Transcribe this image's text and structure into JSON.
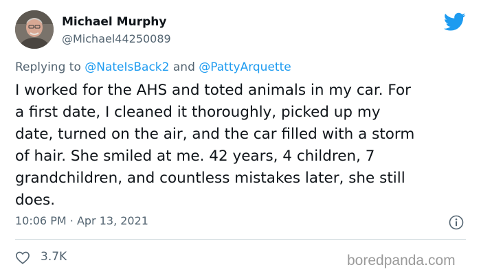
{
  "author": {
    "display_name": "Michael Murphy",
    "handle": "@Michael44250089",
    "avatar_icon": "profile-photo"
  },
  "logo": {
    "icon": "twitter-bird-icon",
    "color": "#1d9bf0"
  },
  "reply": {
    "prefix": "Replying to",
    "user1": "@NateIsBack2",
    "conjunction": "and",
    "user2": "@PattyArquette"
  },
  "tweet": {
    "lines": [
      "I worked for the AHS and toted animals in my car. For",
      "a first date, I cleaned it thoroughly, picked up my",
      "date, turned on the air, and the car filled with a storm",
      "of hair.  She smiled at me.  42 years, 4 children, 7",
      "grandchildren, and countless mistakes later, she still",
      "does."
    ]
  },
  "meta": {
    "time": "10:06 PM",
    "separator": "·",
    "date": "Apr 13, 2021",
    "info_icon": "info-icon"
  },
  "engagement": {
    "like_icon": "heart-icon",
    "likes": "3.7K"
  },
  "watermark": "boredpanda.com",
  "colors": {
    "text": "#0f1419",
    "secondary": "#536471",
    "link": "#1d9bf0",
    "divider": "#cfd9de"
  }
}
